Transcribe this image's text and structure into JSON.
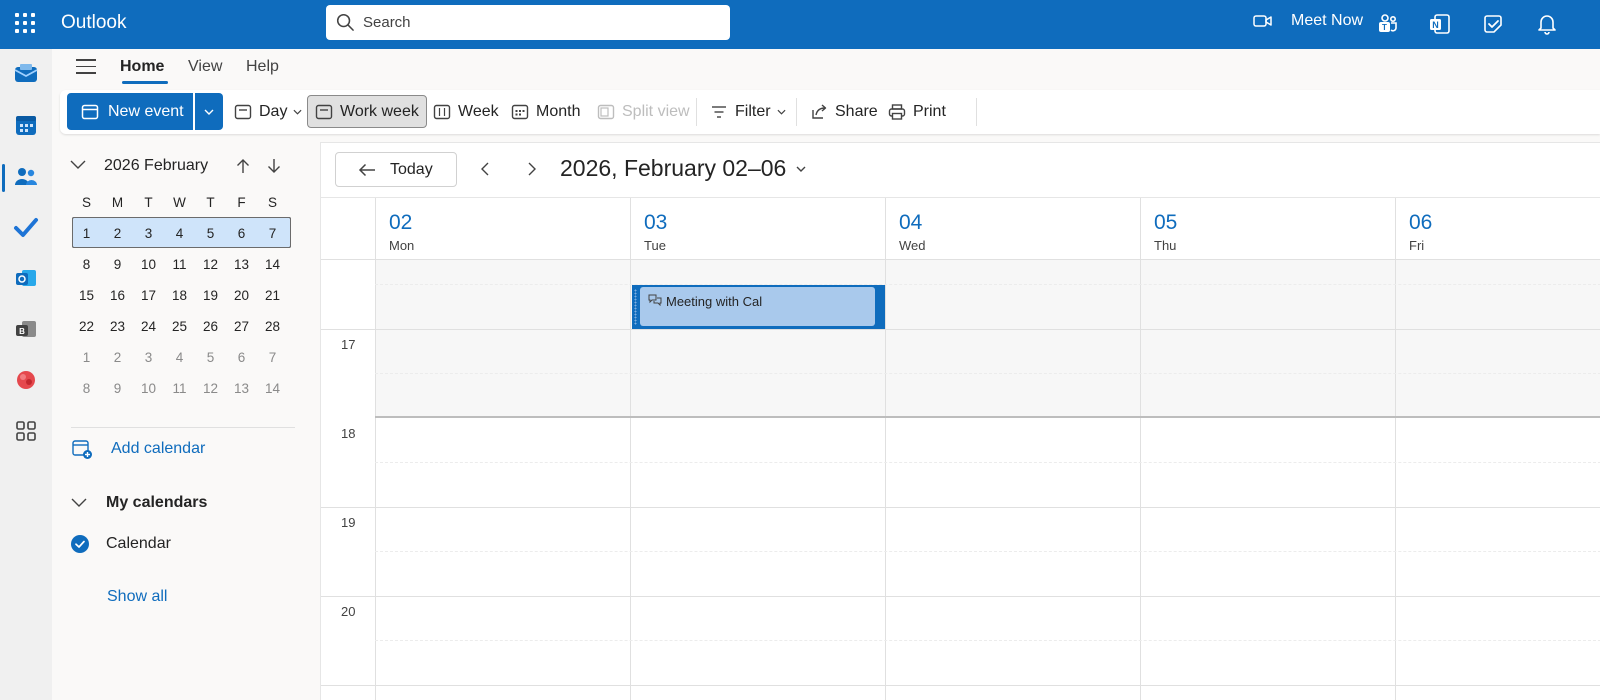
{
  "app": {
    "title": "Outlook"
  },
  "search": {
    "placeholder": "Search"
  },
  "header": {
    "meet_now": "Meet Now"
  },
  "ribbon": {
    "tabs": [
      {
        "label": "Home"
      },
      {
        "label": "View"
      },
      {
        "label": "Help"
      }
    ]
  },
  "toolbar": {
    "new_event": "New event",
    "day": "Day",
    "work_week": "Work week",
    "week": "Week",
    "month": "Month",
    "split_view": "Split view",
    "filter": "Filter",
    "share": "Share",
    "print": "Print"
  },
  "mini_month": {
    "title": "2026 February",
    "dow": [
      "S",
      "M",
      "T",
      "W",
      "T",
      "F",
      "S"
    ],
    "weeks": [
      [
        "1",
        "2",
        "3",
        "4",
        "5",
        "6",
        "7"
      ],
      [
        "8",
        "9",
        "10",
        "11",
        "12",
        "13",
        "14"
      ],
      [
        "15",
        "16",
        "17",
        "18",
        "19",
        "20",
        "21"
      ],
      [
        "22",
        "23",
        "24",
        "25",
        "26",
        "27",
        "28"
      ],
      [
        "1",
        "2",
        "3",
        "4",
        "5",
        "6",
        "7"
      ],
      [
        "8",
        "9",
        "10",
        "11",
        "12",
        "13",
        "14"
      ]
    ]
  },
  "sidebar": {
    "add_calendar": "Add calendar",
    "my_calendars": "My calendars",
    "calendar_item": "Calendar",
    "show_all": "Show all"
  },
  "calendar": {
    "today": "Today",
    "range": "2026, February 02–06",
    "days": [
      {
        "num": "02",
        "name": "Mon"
      },
      {
        "num": "03",
        "name": "Tue"
      },
      {
        "num": "04",
        "name": "Wed"
      },
      {
        "num": "05",
        "name": "Thu"
      },
      {
        "num": "06",
        "name": "Fri"
      }
    ],
    "hours": [
      "17",
      "18",
      "19",
      "20"
    ],
    "event": {
      "title": "Meeting with Cal"
    }
  },
  "colors": {
    "brand": "#0f6cbd",
    "event_fill": "#a9c9ec",
    "selected_week": "#cfe4fa"
  }
}
